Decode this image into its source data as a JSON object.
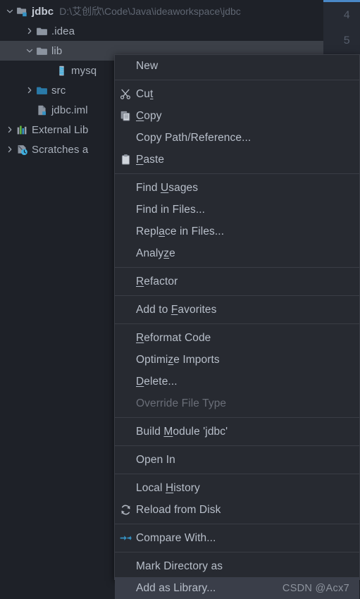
{
  "tree": {
    "rows": [
      {
        "label": "jdbc",
        "path": "D:\\艾创欣\\Code\\Java\\ideaworkspace\\jdbc",
        "icon": "module-folder-icon",
        "arrow": "chevron-down",
        "indent": 0,
        "bold": true,
        "selected": false,
        "name": "tree-item-jdbc"
      },
      {
        "label": ".idea",
        "path": "",
        "icon": "folder-icon",
        "arrow": "chevron-right",
        "indent": 1,
        "bold": false,
        "selected": false,
        "name": "tree-item-idea"
      },
      {
        "label": "lib",
        "path": "",
        "icon": "folder-icon",
        "arrow": "chevron-down",
        "indent": 1,
        "bold": false,
        "selected": true,
        "name": "tree-item-lib"
      },
      {
        "label": "mysq",
        "path": "",
        "icon": "jar-file-icon",
        "arrow": "none",
        "indent": 2,
        "bold": false,
        "selected": false,
        "name": "tree-item-mysql-jar"
      },
      {
        "label": "src",
        "path": "",
        "icon": "source-folder-icon",
        "arrow": "chevron-right",
        "indent": 1,
        "bold": false,
        "selected": false,
        "name": "tree-item-src"
      },
      {
        "label": "jdbc.iml",
        "path": "",
        "icon": "iml-file-icon",
        "arrow": "none",
        "indent": 1,
        "bold": false,
        "selected": false,
        "name": "tree-item-jdbc-iml"
      },
      {
        "label": "External Lib",
        "path": "",
        "icon": "external-libraries-icon",
        "arrow": "chevron-right",
        "indent": 0,
        "bold": false,
        "selected": false,
        "name": "tree-item-external-libraries"
      },
      {
        "label": "Scratches a",
        "path": "",
        "icon": "scratches-icon",
        "arrow": "chevron-right",
        "indent": 0,
        "bold": false,
        "selected": false,
        "name": "tree-item-scratches"
      }
    ]
  },
  "editor": {
    "line_numbers": [
      "4",
      "5"
    ]
  },
  "context_menu": {
    "watermark": "CSDN @Acx7",
    "items": [
      {
        "label": "New",
        "mnemonic": "",
        "icon": "none",
        "state": "normal",
        "name": "menu-item-new"
      },
      {
        "type": "separator"
      },
      {
        "label": "Cut",
        "mnemonic": "t",
        "icon": "scissors-icon",
        "state": "normal",
        "name": "menu-item-cut"
      },
      {
        "label": "Copy",
        "mnemonic": "C",
        "icon": "copy-icon",
        "state": "normal",
        "name": "menu-item-copy"
      },
      {
        "label": "Copy Path/Reference...",
        "mnemonic": "",
        "icon": "none",
        "state": "normal",
        "name": "menu-item-copy-path-reference"
      },
      {
        "label": "Paste",
        "mnemonic": "P",
        "icon": "clipboard-icon",
        "state": "normal",
        "name": "menu-item-paste"
      },
      {
        "type": "separator"
      },
      {
        "label": "Find Usages",
        "mnemonic": "U",
        "icon": "none",
        "state": "normal",
        "name": "menu-item-find-usages"
      },
      {
        "label": "Find in Files...",
        "mnemonic": "",
        "icon": "none",
        "state": "normal",
        "name": "menu-item-find-in-files"
      },
      {
        "label": "Replace in Files...",
        "mnemonic": "a",
        "icon": "none",
        "state": "normal",
        "name": "menu-item-replace-in-files"
      },
      {
        "label": "Analyze",
        "mnemonic": "z",
        "icon": "none",
        "state": "normal",
        "name": "menu-item-analyze"
      },
      {
        "type": "separator"
      },
      {
        "label": "Refactor",
        "mnemonic": "R",
        "icon": "none",
        "state": "normal",
        "name": "menu-item-refactor"
      },
      {
        "type": "separator"
      },
      {
        "label": "Add to Favorites",
        "mnemonic": "F",
        "icon": "none",
        "state": "normal",
        "name": "menu-item-add-to-favorites"
      },
      {
        "type": "separator"
      },
      {
        "label": "Reformat Code",
        "mnemonic": "R",
        "icon": "none",
        "state": "normal",
        "name": "menu-item-reformat-code"
      },
      {
        "label": "Optimize Imports",
        "mnemonic": "z",
        "icon": "none",
        "state": "normal",
        "name": "menu-item-optimize-imports"
      },
      {
        "label": "Delete...",
        "mnemonic": "D",
        "icon": "none",
        "state": "normal",
        "name": "menu-item-delete"
      },
      {
        "label": "Override File Type",
        "mnemonic": "",
        "icon": "none",
        "state": "disabled",
        "name": "menu-item-override-file-type"
      },
      {
        "type": "separator"
      },
      {
        "label": "Build Module 'jdbc'",
        "mnemonic": "M",
        "icon": "none",
        "state": "normal",
        "name": "menu-item-build-module"
      },
      {
        "type": "separator"
      },
      {
        "label": "Open In",
        "mnemonic": "",
        "icon": "none",
        "state": "normal",
        "name": "menu-item-open-in"
      },
      {
        "type": "separator"
      },
      {
        "label": "Local History",
        "mnemonic": "H",
        "icon": "none",
        "state": "normal",
        "name": "menu-item-local-history"
      },
      {
        "label": "Reload from Disk",
        "mnemonic": "",
        "icon": "refresh-icon",
        "state": "normal",
        "name": "menu-item-reload-from-disk"
      },
      {
        "type": "separator"
      },
      {
        "label": "Compare With...",
        "mnemonic": "",
        "icon": "compare-icon",
        "state": "normal",
        "name": "menu-item-compare-with"
      },
      {
        "type": "separator"
      },
      {
        "label": "Mark Directory as",
        "mnemonic": "",
        "icon": "none",
        "state": "normal",
        "name": "menu-item-mark-directory-as"
      },
      {
        "label": "Add as Library...",
        "mnemonic": "",
        "icon": "none",
        "state": "highlighted",
        "name": "menu-item-add-as-library"
      }
    ]
  },
  "colors": {
    "panel_bg": "#1e2128",
    "menu_bg": "#272a31",
    "menu_text": "#b8bfca",
    "menu_disabled": "#6a6e78",
    "highlight": "#3a3e49",
    "selection": "#3c4048",
    "accent_blue": "#4a88c7",
    "separator": "#3a3d45"
  }
}
